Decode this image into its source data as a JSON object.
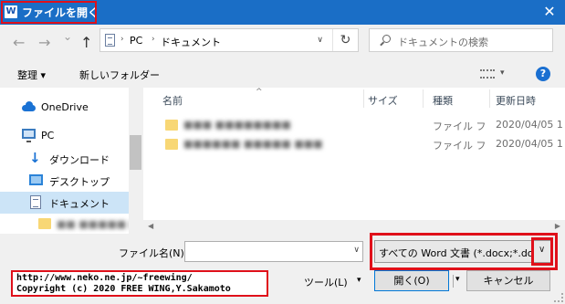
{
  "window": {
    "title": "ファイルを開く",
    "app_icon_letter": "W",
    "close_glyph": "✕"
  },
  "nav": {
    "back_glyph": "←",
    "forward_glyph": "→",
    "recent_glyph": "⌄",
    "up_glyph": "↑"
  },
  "address": {
    "segments": [
      "PC",
      "ドキュメント"
    ],
    "separator": "›",
    "refresh_glyph": "↻"
  },
  "search": {
    "placeholder": "ドキュメントの検索"
  },
  "toolbar": {
    "organize": "整理 ▾",
    "new_folder": "新しいフォルダー",
    "help": "?"
  },
  "sidebar": {
    "items": [
      {
        "label": "OneDrive",
        "icon": "onedrive-cloud-icon"
      },
      {
        "label": "PC",
        "icon": "pc-icon"
      },
      {
        "label": "ダウンロード",
        "icon": "download-icon"
      },
      {
        "label": "デスクトップ",
        "icon": "desktop-icon"
      },
      {
        "label": "ドキュメント",
        "icon": "documents-icon",
        "selected": true
      },
      {
        "label": "■■ ■■■■■ ■■",
        "icon": "folder-icon",
        "blurred": true
      }
    ]
  },
  "file_list": {
    "columns": [
      "名前",
      "サイズ",
      "種類",
      "更新日時"
    ],
    "rows": [
      {
        "name": "■■■ ■■■■■■■■",
        "type": "ファイル フ",
        "modified": "2020/04/05 1"
      },
      {
        "name": "■■■■■■ ■■■■■ ■■■",
        "type": "ファイル フ",
        "modified": "2020/04/05 1"
      }
    ]
  },
  "bottom": {
    "filename_label": "ファイル名(N):",
    "filename_value": "",
    "filter_value": "すべての Word 文書 (*.docx;*.doc",
    "url_line1": "http://www.neko.ne.jp/~freewing/",
    "url_line2": "Copyright (c) 2020 FREE WING,Y.Sakamoto",
    "tools_label": "ツール(L)",
    "open_label": "開く(O)",
    "cancel_label": "キャンセル"
  },
  "colors": {
    "titlebar": "#1a6ec6",
    "highlight": "#e0101a",
    "selected": "#cce4f7",
    "folder": "#f8d775"
  }
}
